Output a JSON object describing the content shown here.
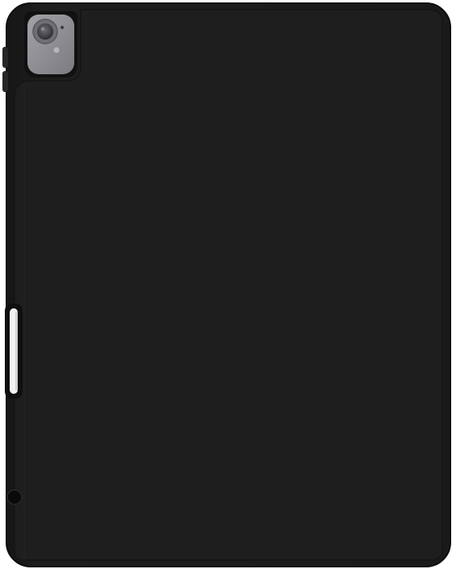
{
  "product": {
    "case_color": "#1b1b1b",
    "case_edge_color": "#0e0e0e",
    "cover_flap_color": "#1f1f1f",
    "camera_surround_color": "#8e8d92",
    "camera_lens_color": "#5a5a5e",
    "pencil_color": "#f2f2f2",
    "button_color": "#2a2a2a"
  }
}
